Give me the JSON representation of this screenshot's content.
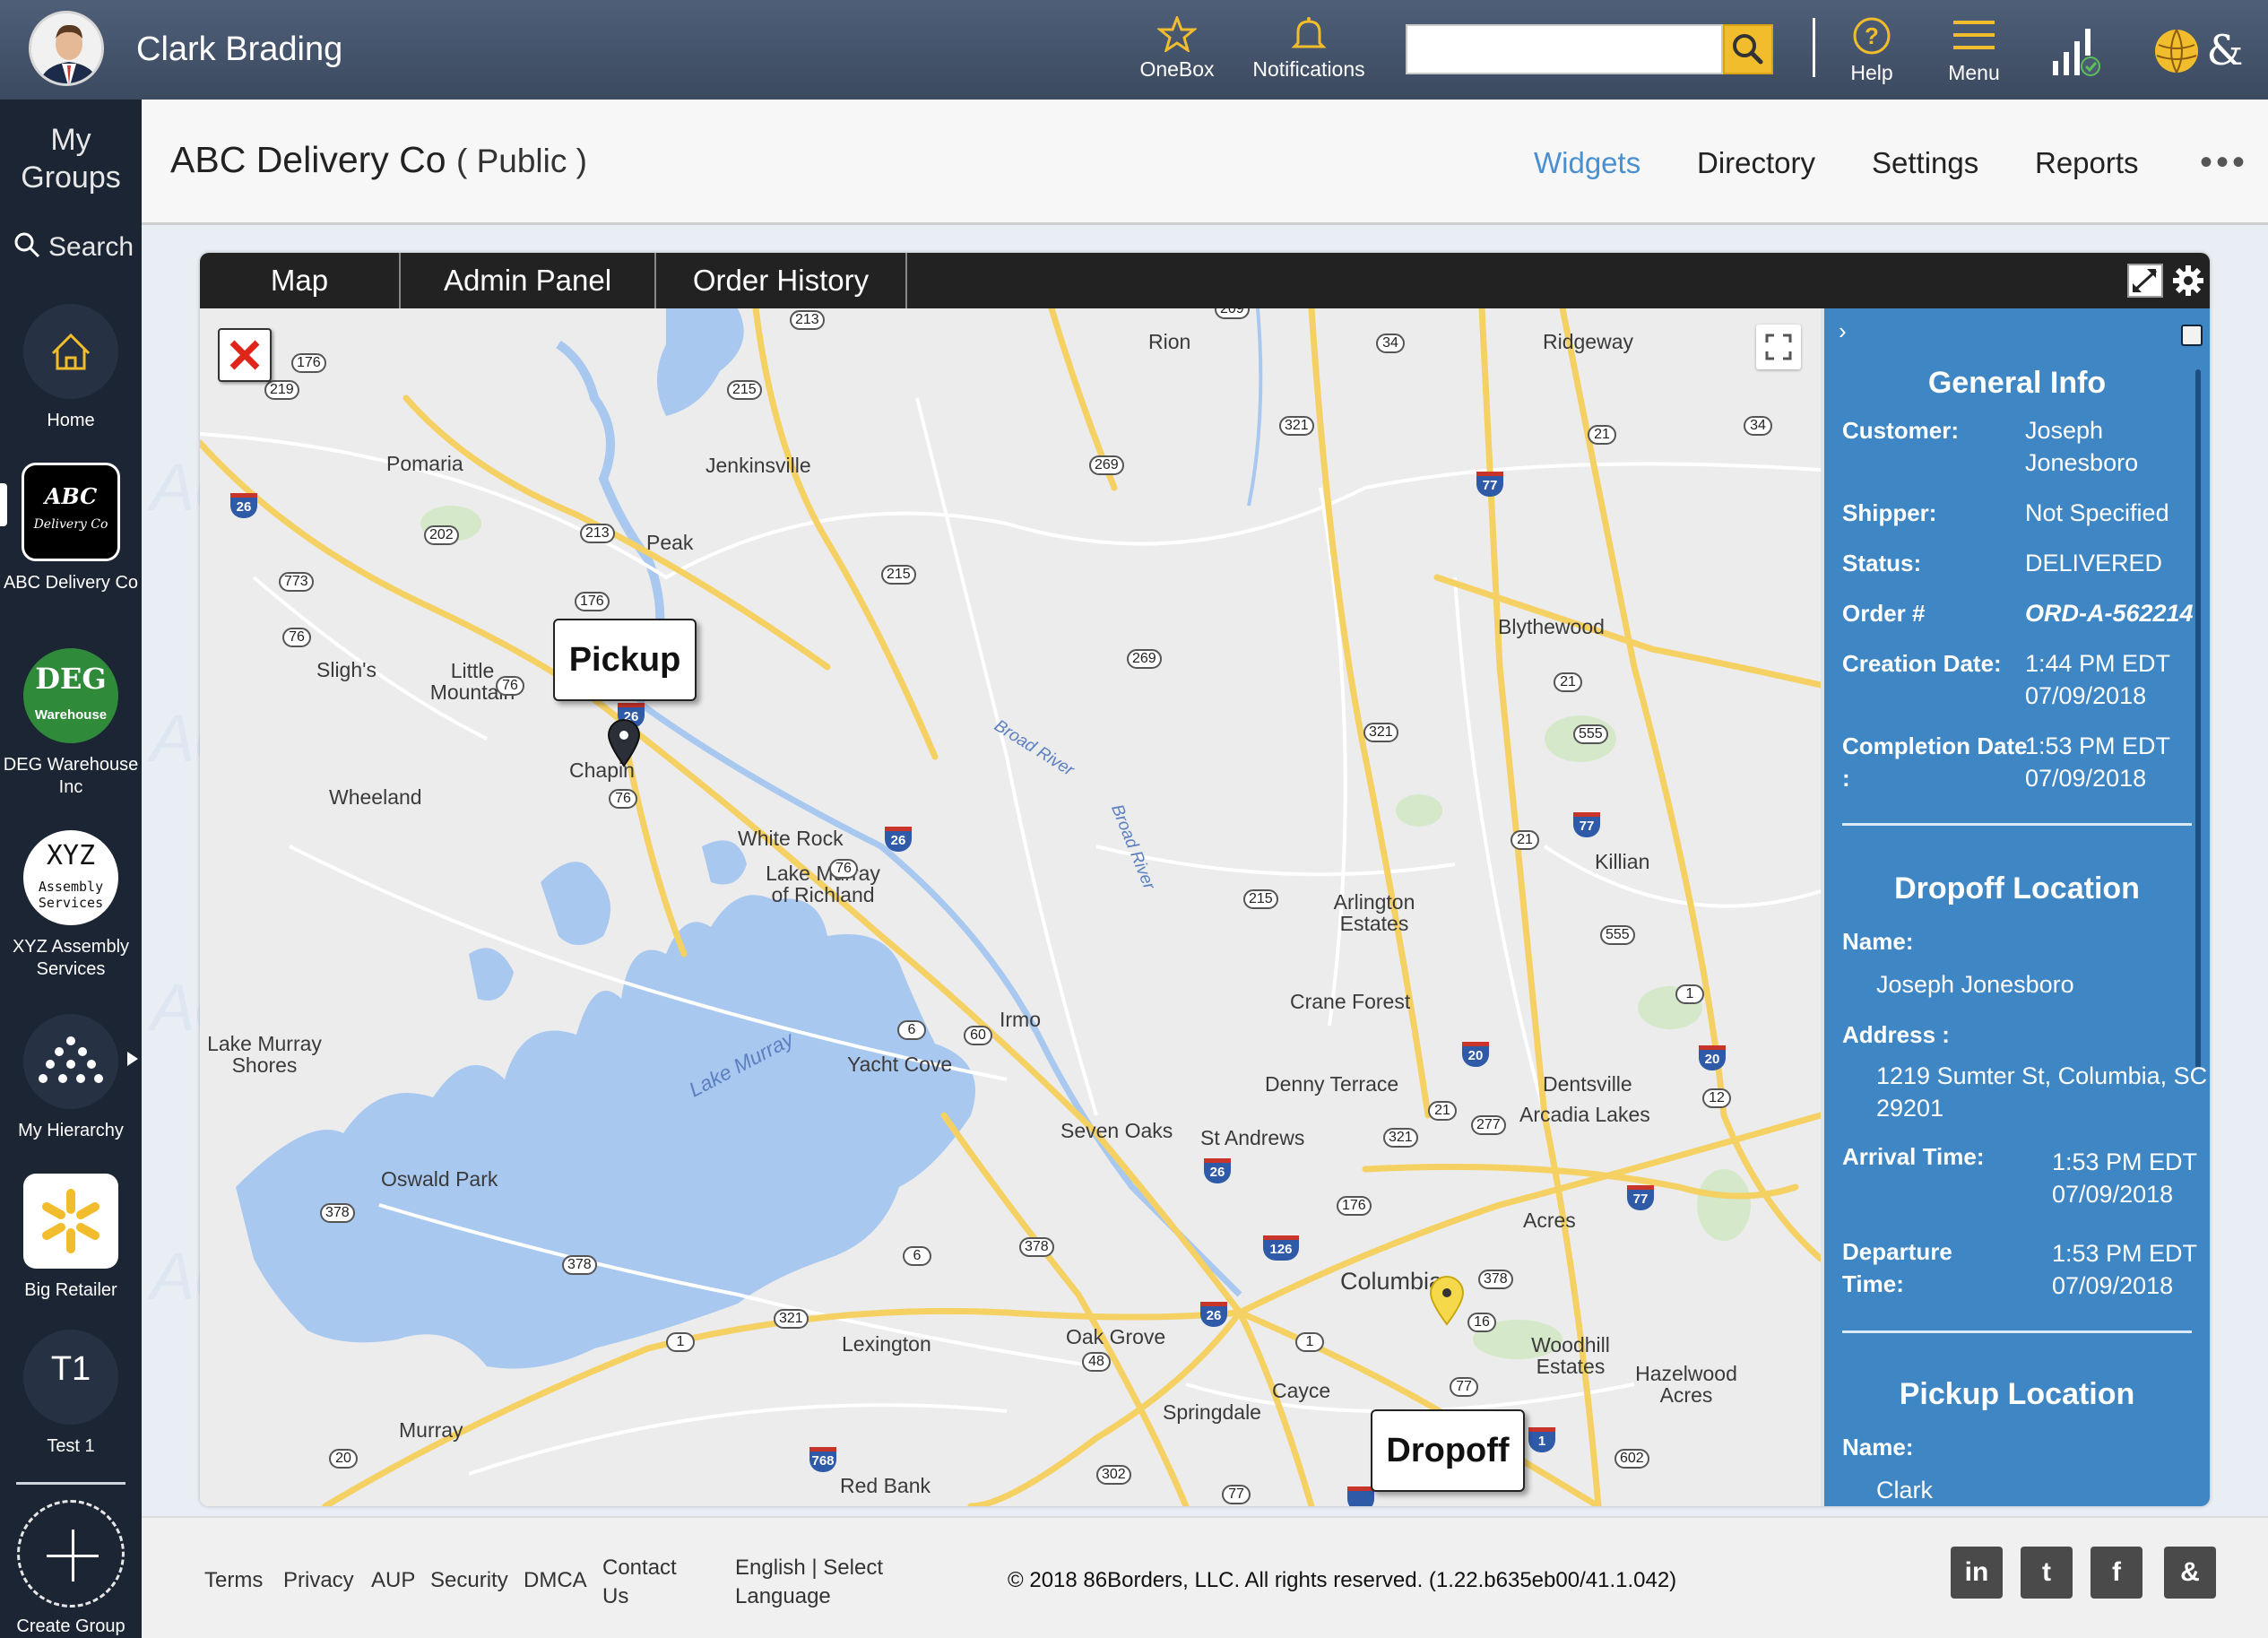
{
  "colors": {
    "topbar": "#455570",
    "sidebar": "#1b2533",
    "accent": "#4a90d0",
    "info_panel": "#3f86c4",
    "search_button": "#f2bd2c",
    "highway": "#f5d163"
  },
  "topbar": {
    "user_name": "Clark Brading",
    "onebox_label": "OneBox",
    "notifications_label": "Notifications",
    "search_placeholder": "",
    "help_label": "Help",
    "menu_label": "Menu"
  },
  "sidebar": {
    "my_groups": "My Groups",
    "search": "Search",
    "groups": [
      {
        "label": "Home",
        "icon": "home-icon"
      },
      {
        "label": "ABC Delivery Co",
        "logo_text": "ABC Delivery Co"
      },
      {
        "label": "DEG Warehouse Inc",
        "logo_text": "DEG",
        "logo_sub": "Warehouse"
      },
      {
        "label": "XYZ Assembly Services",
        "logo_text": "XYZ",
        "logo_sub": "Assembly Services"
      },
      {
        "label": "My Hierarchy",
        "icon": "hierarchy-icon"
      },
      {
        "label": "Big Retailer",
        "icon": "spark-icon"
      },
      {
        "label": "Test 1",
        "logo_text": "T1"
      }
    ],
    "create_group": "Create Group"
  },
  "group_header": {
    "title": "ABC Delivery Co",
    "visibility": "( Public )",
    "nav": [
      "Widgets",
      "Directory",
      "Settings",
      "Reports"
    ],
    "more": "•••"
  },
  "widget": {
    "tabs": [
      "Map",
      "Admin Panel",
      "Order History"
    ],
    "active_tab": "Order History"
  },
  "map": {
    "pickup_label": "Pickup",
    "dropoff_label": "Dropoff",
    "places": [
      "Rion",
      "Ridgeway",
      "Pomaria",
      "Jenkinsville",
      "Peak",
      "Blythewood",
      "Sligh's",
      "Little Mountain",
      "Chapin",
      "Wheeland",
      "White Rock",
      "Lake Murray of Richland",
      "Killian",
      "Arlington Estates",
      "Crane Forest",
      "Irmo",
      "Lake Murray Shores",
      "Yacht Cove",
      "Denny Terrace",
      "Dentsville",
      "Arcadia Lakes",
      "Seven Oaks",
      "St Andrews",
      "Oswald Park",
      "Acres",
      "Columbia",
      "Lexington",
      "Oak Grove",
      "Woodhill Estates",
      "Hazelwood Acres",
      "Cayce",
      "Springdale",
      "Murray",
      "Red Bank"
    ],
    "waters": [
      "Broad River",
      "Broad River",
      "Lake Murray"
    ],
    "route_shields": [
      "213",
      "209",
      "176",
      "219",
      "215",
      "34",
      "321",
      "269",
      "21",
      "34",
      "26",
      "202",
      "213",
      "77",
      "773",
      "176",
      "215",
      "76",
      "269",
      "76",
      "21",
      "26",
      "321",
      "555",
      "76",
      "26",
      "77",
      "21",
      "215",
      "555",
      "76",
      "1",
      "6",
      "60",
      "20",
      "20",
      "21",
      "277",
      "12",
      "321",
      "378",
      "26",
      "77",
      "176",
      "126",
      "6",
      "378",
      "378",
      "378",
      "16",
      "26",
      "321",
      "1",
      "1",
      "48",
      "77",
      "1",
      "20",
      "768",
      "602",
      "302",
      "77"
    ]
  },
  "info_panel": {
    "general_info": {
      "heading": "General Info",
      "customer_label": "Customer:",
      "customer": "Joseph Jonesboro",
      "shipper_label": "Shipper:",
      "shipper": "Not Specified",
      "status_label": "Status:",
      "status": "DELIVERED",
      "order_label": "Order #",
      "order": "ORD-A-562214",
      "creation_label": "Creation Date:",
      "creation_time": "1:44 PM EDT",
      "creation_date": "07/09/2018",
      "completion_label": "Completion Date",
      "completion_colon": ":",
      "completion_time": "1:53 PM EDT",
      "completion_date": "07/09/2018"
    },
    "dropoff": {
      "heading": "Dropoff Location",
      "name_label": "Name:",
      "name": "Joseph Jonesboro",
      "address_label": "Address :",
      "address_line1": "1219 Sumter St, Columbia, SC",
      "address_line2": "29201",
      "arrival_label": "Arrival Time:",
      "arrival_time": "1:53 PM EDT",
      "arrival_date": "07/09/2018",
      "departure_label1": "Departure",
      "departure_label2": "Time:",
      "departure_time": "1:53 PM EDT",
      "departure_date": "07/09/2018"
    },
    "pickup": {
      "heading": "Pickup Location",
      "name_label": "Name:",
      "name": "Clark"
    }
  },
  "footer": {
    "links": [
      "Terms",
      "Privacy",
      "AUP",
      "Security",
      "DMCA"
    ],
    "contact": [
      "Contact",
      "Us"
    ],
    "language": [
      "English | Select",
      "Language"
    ],
    "copyright": "© 2018 86Borders, LLC. All rights reserved. (1.22.b635eb00/41.1.042)",
    "social": [
      "in",
      "t",
      "f",
      "&"
    ]
  },
  "watermark": "Ac"
}
